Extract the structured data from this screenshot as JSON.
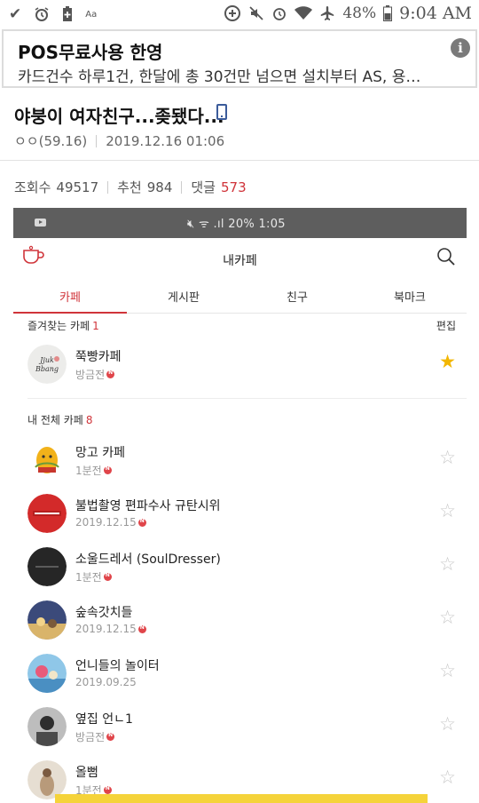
{
  "status_bar": {
    "battery_percent": "48%",
    "time": "9:04 AM",
    "left_icons": [
      "check-icon",
      "alarm-icon",
      "battery-saver-icon",
      "font-icon"
    ],
    "right_icons": [
      "data-saver-icon",
      "mute-icon",
      "alarm-icon",
      "wifi-icon",
      "airplane-icon",
      "battery-icon"
    ]
  },
  "ad": {
    "title": "POS무료사용 한영",
    "description": "카드건수 하루1건, 한달에 총 30건만 넘으면 설치부터 AS, 용…",
    "info_glyph": "i"
  },
  "post": {
    "title": "야붕이 여자친구...좆됐다...",
    "author": "ㅇㅇ(59.16)",
    "datetime": "2019.12.16 01:06",
    "views_label": "조회수",
    "views": "49517",
    "recommend_label": "추천",
    "recommend": "984",
    "comments_label": "댓글",
    "comments": "573"
  },
  "screenshot": {
    "status_text": "20% 1:05",
    "header_title": "내카페",
    "tabs": [
      {
        "label": "카페",
        "active": true
      },
      {
        "label": "게시판",
        "active": false
      },
      {
        "label": "친구",
        "active": false
      },
      {
        "label": "북마크",
        "active": false
      }
    ],
    "favorites_label": "즐겨찾는 카페",
    "favorites_count": "1",
    "edit_label": "편집",
    "favorites": [
      {
        "name": "쭉빵카페",
        "sub": "방금전",
        "starred": true
      }
    ],
    "all_label": "내 전체 카페",
    "all_count": "8",
    "cafes": [
      {
        "name": "망고 카페",
        "sub": "1분전",
        "new": true
      },
      {
        "name": "불법촬영 편파수사 규탄시위",
        "sub": "2019.12.15",
        "new": true
      },
      {
        "name": "소울드레서 (SoulDresser)",
        "sub": "1분전",
        "new": true
      },
      {
        "name": "숲속갓치들",
        "sub": "2019.12.15",
        "new": true
      },
      {
        "name": "언니들의 놀이터",
        "sub": "2019.09.25",
        "new": false
      },
      {
        "name": "옆집 언ㄴ1",
        "sub": "방금전",
        "new": true
      },
      {
        "name": "올뻠",
        "sub": "1분전",
        "new": true
      }
    ],
    "colors": {
      "accent": "#d0343a",
      "star_on": "#f2b600"
    }
  }
}
